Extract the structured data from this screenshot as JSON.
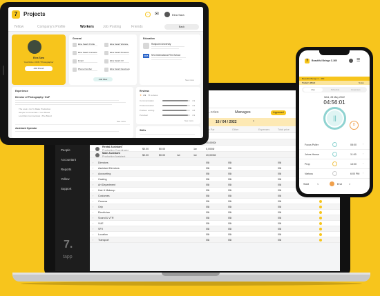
{
  "colors": {
    "accent": "#f7c51c",
    "teal": "#8fd3d1",
    "orange": "#f0a04b",
    "dark": "#1d1d1d"
  },
  "laptop": {
    "sidebar": {
      "items": [
        "Messages",
        "Contacts",
        "People",
        "Accountant",
        "Reports",
        "Yellow",
        "Support"
      ],
      "logo_glyph": "7.",
      "logo_text": "tapp"
    },
    "topbar": {
      "user": "Kate"
    },
    "tabs": [
      "...ories",
      "Manages",
      "Approved",
      "Search"
    ],
    "date": "16 / 04 / 2022",
    "header_cells": [
      "Item No.",
      "Per Par",
      "Other",
      "Expenses",
      "Total price"
    ],
    "top_rows": [
      [
        "Film Director",
        "Line Producer",
        "",
        "",
        "",
        "",
        ""
      ],
      [
        "Digital Storyboards",
        "Production Manager",
        "$0.00",
        "$0.00",
        "1w",
        "1w",
        "10,000₪"
      ],
      [
        "Rental Assistant",
        "Production Coordinator",
        "$0.00",
        "$0.00",
        "",
        "1w",
        "5,000₪"
      ],
      [
        "Main Assistant",
        "Production Assistant",
        "$0.00",
        "$0.00",
        "1w",
        "1w",
        "20,000₪"
      ]
    ],
    "categories": [
      {
        "name": "Directors",
        "a": "0₪",
        "b": "0₪",
        "c": "",
        "d": "0₪"
      },
      {
        "name": "Assistant Directors",
        "a": "0₪",
        "b": "0₪",
        "c": "",
        "d": "0₪"
      },
      {
        "name": "Accounting",
        "a": "0₪",
        "b": "0₪",
        "c": "",
        "d": "0₪"
      },
      {
        "name": "Casting",
        "a": "0₪",
        "b": "0₪",
        "c": "",
        "d": "0₪"
      },
      {
        "name": "Art Department",
        "a": "0₪",
        "b": "0₪",
        "c": "",
        "d": "0₪"
      },
      {
        "name": "Hair & Makeup",
        "a": "0₪",
        "b": "0₪",
        "c": "",
        "d": "0₪"
      },
      {
        "name": "Costumes",
        "a": "0₪",
        "b": "0₪",
        "c": "",
        "d": "0₪"
      },
      {
        "name": "Camera",
        "a": "0₪",
        "b": "0₪",
        "c": "",
        "d": "0₪"
      },
      {
        "name": "Grip",
        "a": "0₪",
        "b": "0₪",
        "c": "",
        "d": "0₪"
      },
      {
        "name": "Electrician",
        "a": "0₪",
        "b": "0₪",
        "c": "",
        "d": "0₪"
      },
      {
        "name": "Sound & VTR",
        "a": "0₪",
        "b": "0₪",
        "c": "",
        "d": "0₪"
      },
      {
        "name": "VUE",
        "a": "0₪",
        "b": "0₪",
        "c": "",
        "d": "0₪"
      },
      {
        "name": "SFX",
        "a": "0₪",
        "b": "0₪",
        "c": "",
        "d": "0₪"
      },
      {
        "name": "Location",
        "a": "0₪",
        "b": "0₪",
        "c": "",
        "d": "0₪"
      },
      {
        "name": "Transport",
        "a": "0₪",
        "b": "0₪",
        "c": "",
        "d": "0₪"
      }
    ]
  },
  "tablet": {
    "app_title": "Projects",
    "user_name": "Elna Sara",
    "tabs": [
      "Yellow",
      "Company's Profile",
      "Workers",
      "Job Posting",
      "Friends"
    ],
    "active_tab": "Workers",
    "back_label": "Back",
    "profile": {
      "name": "Elna Sara",
      "role": "Your Role • DOP / Photographer",
      "button": "Add Friend"
    },
    "general": {
      "heading": "General",
      "items": [
        "Elna Sarah Profile",
        "Elna Sarah Contacts",
        "Email",
        "Phone Number",
        "Elna Sarah Website",
        "Elna Sarah Pinterest",
        "Elna Sarah CV",
        "Elna Sarah Facebook"
      ],
      "button": "Add Files"
    },
    "education": {
      "heading": "Education",
      "items": [
        "Rostpoint University",
        "NYA International Film School"
      ],
      "see_more": "See more"
    },
    "experience": {
      "heading": "Experience",
      "job1": "Director of Photography / DoP",
      "job1_bullets": [
        "The Look • Co To Make Production",
        "Simple Commercials • Your Brand",
        "Lost Rain Commercials • The Brand"
      ],
      "job2": "Assistant Operator",
      "see_more": "See more"
    },
    "reviews": {
      "heading": "Reviews",
      "score": "4.9",
      "count": "76 reviews",
      "rows": [
        {
          "label": "Communication",
          "value": 0.92,
          "score": "4.9"
        },
        {
          "label": "Professionalism",
          "value": 0.9,
          "score": "4.9"
        },
        {
          "label": "Problem solving",
          "value": 0.88,
          "score": "4.8"
        },
        {
          "label": "Punctual",
          "value": 0.93,
          "score": "4.9"
        }
      ],
      "see_more": "See more"
    },
    "skills": {
      "heading": "Skills"
    }
  },
  "phone": {
    "project_name": "Beautiful Beings C-360",
    "stripe_label": "Beautiful Beings C - 360",
    "todays_work": "Today's Work",
    "notes": "Notes",
    "tabs": [
      "Live",
      "Schedule",
      "Expenses"
    ],
    "date": "Wed, 28 May 2022",
    "timer": "04:56:01",
    "rows": [
      {
        "label": "Focus Puller",
        "time": "08:00",
        "color": "#8fd3d1"
      },
      {
        "label": "Johns House",
        "time": "11:00",
        "color": "#8fd3d1"
      },
      {
        "label": "Prop",
        "time": "13:00",
        "color": "#f0c24b"
      },
      {
        "label": "Various",
        "time": "6:00 PM",
        "color": "#cccccc"
      }
    ],
    "start_label": "Start",
    "end_label": "End"
  }
}
